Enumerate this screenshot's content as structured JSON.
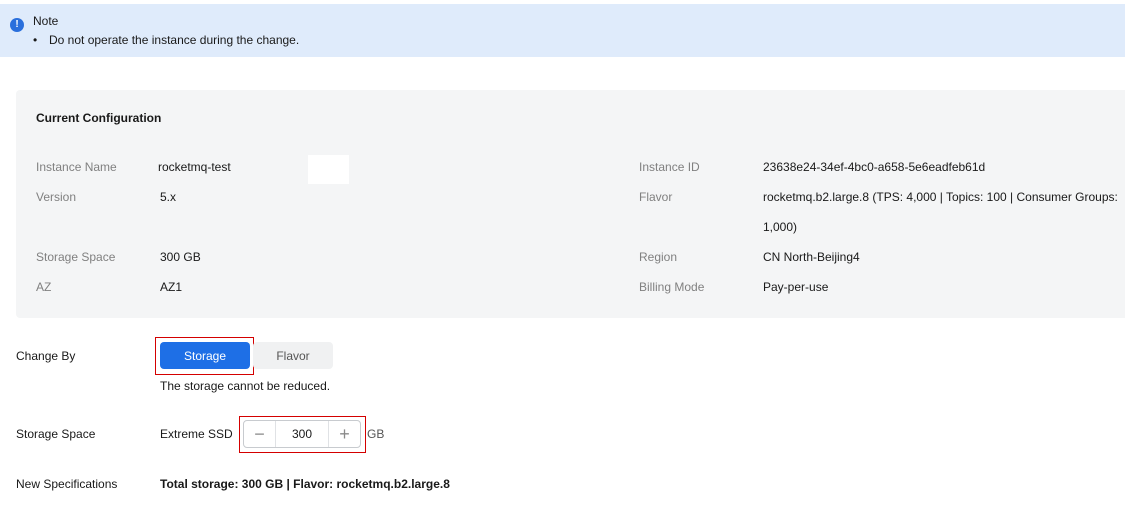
{
  "note": {
    "icon": "info-icon",
    "title": "Note",
    "items": [
      "Do not operate the instance during the change."
    ]
  },
  "config": {
    "title": "Current Configuration",
    "left": [
      {
        "label": "Instance Name",
        "value": "rocketmq-test"
      },
      {
        "label": "Version",
        "value": "5.x"
      },
      {
        "label": "Storage Space",
        "value": "300 GB"
      },
      {
        "label": "AZ",
        "value": "AZ1"
      }
    ],
    "right": [
      {
        "label": "Instance ID",
        "value": "23638e24-34ef-4bc0-a658-5e6eadfeb61d"
      },
      {
        "label": "Flavor",
        "value_line1": "rocketmq.b2.large.8 (TPS: 4,000 | Topics: 100 | Consumer Groups:",
        "value_line2": "1,000)"
      },
      {
        "label": "Region",
        "value": "CN North-Beijing4"
      },
      {
        "label": "Billing Mode",
        "value": "Pay-per-use"
      }
    ]
  },
  "change_by": {
    "label": "Change By",
    "options": [
      "Storage",
      "Flavor"
    ],
    "selected": "Storage",
    "hint": "The storage cannot be reduced."
  },
  "storage_space": {
    "label": "Storage Space",
    "disk_type": "Extreme SSD",
    "value": "300",
    "unit": "GB",
    "minus": "−",
    "plus": "+"
  },
  "new_specs": {
    "label": "New Specifications",
    "value": "Total storage: 300 GB | Flavor: rocketmq.b2.large.8"
  },
  "colors": {
    "accent": "#1e6fe6",
    "note_bg": "#dfebfb",
    "highlight": "#d40000"
  }
}
